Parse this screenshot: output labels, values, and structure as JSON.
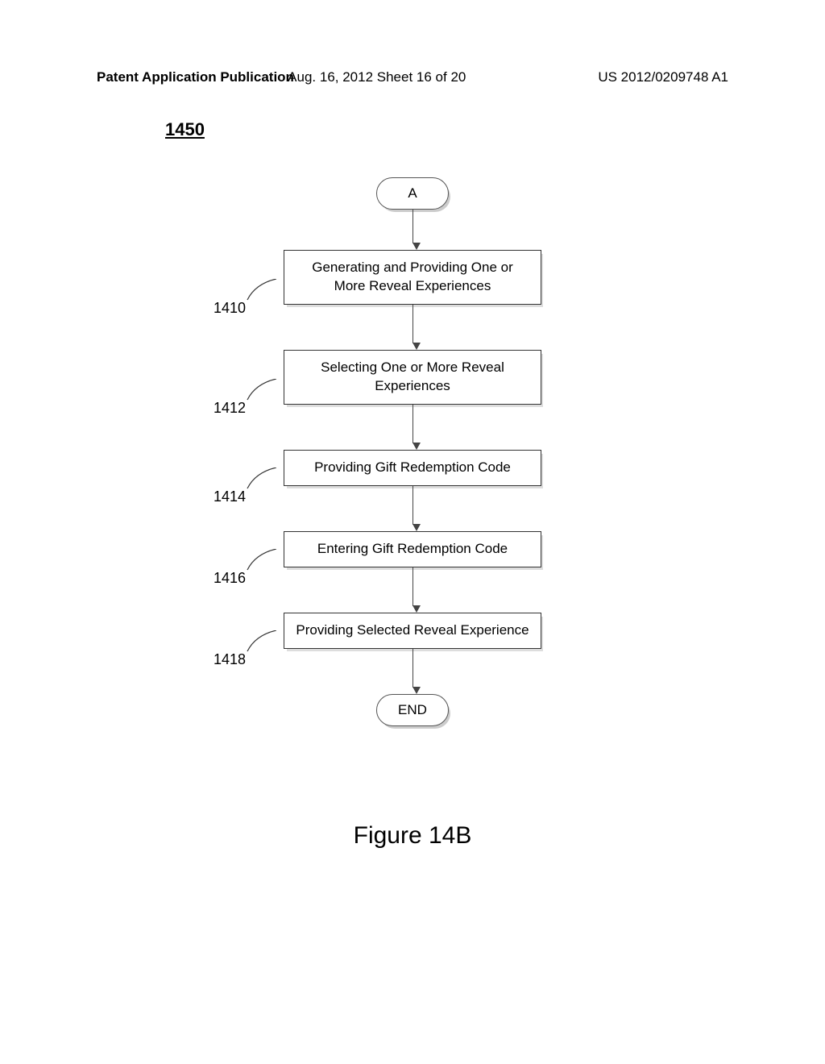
{
  "header": {
    "left": "Patent Application Publication",
    "center": "Aug. 16, 2012  Sheet 16 of 20",
    "right": "US 2012/0209748 A1"
  },
  "figure_ref": "1450",
  "flowchart": {
    "start": "A",
    "steps": [
      {
        "ref": "1410",
        "text": "Generating and Providing One or More Reveal Experiences"
      },
      {
        "ref": "1412",
        "text": "Selecting One or More Reveal Experiences"
      },
      {
        "ref": "1414",
        "text": "Providing Gift Redemption Code"
      },
      {
        "ref": "1416",
        "text": "Entering Gift Redemption Code"
      },
      {
        "ref": "1418",
        "text": "Providing Selected Reveal Experience"
      }
    ],
    "end": "END"
  },
  "caption": "Figure 14B"
}
